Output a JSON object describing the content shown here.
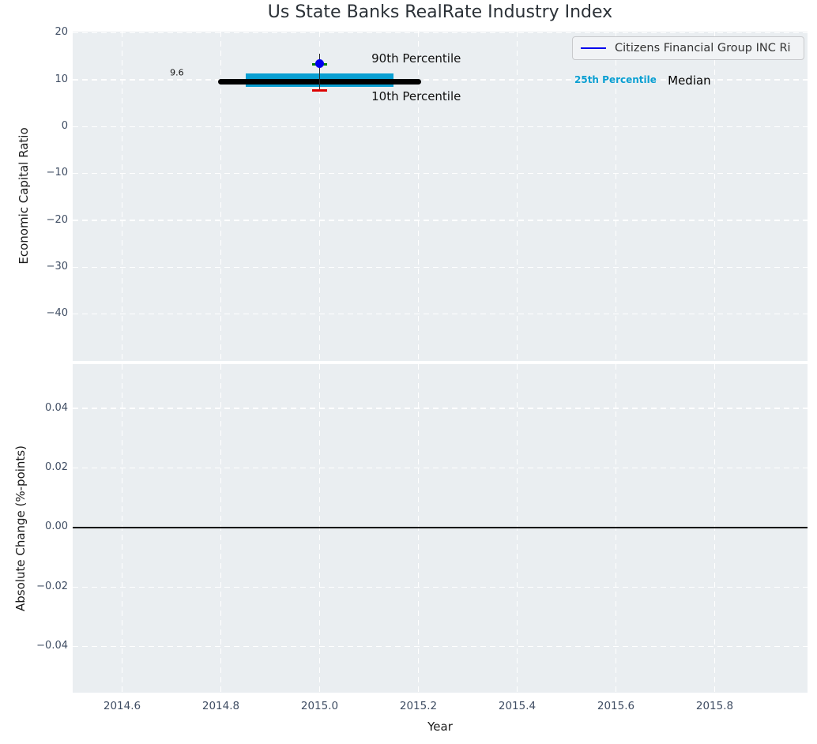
{
  "title": "Us State Banks RealRate Industry Index",
  "style": {
    "figure_bg": "#ffffff",
    "plot_bg": "#eaeef1",
    "grid_color": "#ffffff",
    "tick_label_color": "#3f4d63",
    "axis_label_color": "#1a1a1a",
    "title_color": "#2b3137",
    "legend_bg": "#f1f3f5",
    "legend_border": "#c8c9cc",
    "accent_blue": "#0000ee",
    "accent_cyan": "#0a9fd2",
    "accent_green": "#008000",
    "accent_red": "#dd0000"
  },
  "chart_data": [
    {
      "type": "line",
      "title": "Us State Banks RealRate Industry Index",
      "ylabel": "Economic Capital Ratio",
      "xlabel": "",
      "xlim": [
        2014.5,
        2015.988
      ],
      "ylim": [
        -50.0,
        20.3
      ],
      "grid": "white dashed, on",
      "legend_position": "upper right",
      "legend": {
        "label": "Citizens Financial Group INC Ri",
        "color": "#0000ee"
      },
      "xticks": [
        {
          "label": "2014.6",
          "value": 2014.6
        },
        {
          "label": "2014.8",
          "value": 2014.8
        },
        {
          "label": "2015.0",
          "value": 2015.0
        },
        {
          "label": "2015.2",
          "value": 2015.2
        },
        {
          "label": "2015.4",
          "value": 2015.4
        },
        {
          "label": "2015.6",
          "value": 2015.6
        },
        {
          "label": "2015.8",
          "value": 2015.8
        }
      ],
      "xtick_labels_visible": false,
      "yticks": [
        {
          "label": "20",
          "value": 20
        },
        {
          "label": "10",
          "value": 10
        },
        {
          "label": "0",
          "value": 0
        },
        {
          "label": "−10",
          "value": -10
        },
        {
          "label": "−20",
          "value": -20
        },
        {
          "label": "−30",
          "value": -30
        },
        {
          "label": "−40",
          "value": -40
        }
      ],
      "series": [
        {
          "name": "25th-75th Percentile Band",
          "type": "area",
          "color": "#0a9fd2",
          "x": [
            2014.85,
            2015.15
          ],
          "y_high": [
            11.4,
            11.4
          ],
          "y_low": [
            8.5,
            8.5
          ]
        },
        {
          "name": "Median",
          "type": "line",
          "color": "#000000",
          "linewidth": 7,
          "x": [
            2014.8,
            2015.2
          ],
          "y": [
            9.6,
            9.6
          ]
        },
        {
          "name": "Citizens Financial Group INC Ri",
          "type": "scatter",
          "color": "#0000ee",
          "marker_size": 11,
          "x": [
            2015.0
          ],
          "y": [
            13.5
          ],
          "whisker": {
            "x": 2015.0,
            "y_high": 15.5,
            "y_low": 7.6,
            "line_color": "#2b2b2b",
            "cap_high": {
              "value": 13.3,
              "color": "#008000",
              "meaning": "90th Percentile"
            },
            "cap_low": {
              "value": 7.7,
              "color": "#dd0000",
              "meaning": "10th Percentile"
            }
          }
        }
      ],
      "annotations": [
        {
          "text": "9.6",
          "x": 2014.711,
          "y": 11.5,
          "color": "#111111",
          "size": 11,
          "bold": false,
          "anchor": "center"
        },
        {
          "text": "90th Percentile",
          "x": 2015.105,
          "y": 14.6,
          "color": "#111111",
          "size": 15,
          "bold": false,
          "anchor": "left"
        },
        {
          "text": "10th Percentile",
          "x": 2015.105,
          "y": 6.5,
          "color": "#111111",
          "size": 15,
          "bold": false,
          "anchor": "left"
        },
        {
          "text": "25th Percentile",
          "x": 2015.516,
          "y": 10.1,
          "color": "#0a9fd2",
          "size": 12,
          "bold": true,
          "anchor": "left"
        },
        {
          "text": "Median",
          "x": 2015.705,
          "y": 9.9,
          "color": "#000000",
          "size": 15,
          "bold": false,
          "anchor": "left"
        }
      ]
    },
    {
      "type": "line",
      "title": "",
      "ylabel": "Absolute Change (%-points)",
      "xlabel": "Year",
      "xlim": [
        2014.5,
        2015.988
      ],
      "ylim": [
        -0.0555,
        0.0549
      ],
      "grid": "white dashed, on",
      "xticks": [
        {
          "label": "2014.6",
          "value": 2014.6
        },
        {
          "label": "2014.8",
          "value": 2014.8
        },
        {
          "label": "2015.0",
          "value": 2015.0
        },
        {
          "label": "2015.2",
          "value": 2015.2
        },
        {
          "label": "2015.4",
          "value": 2015.4
        },
        {
          "label": "2015.6",
          "value": 2015.6
        },
        {
          "label": "2015.8",
          "value": 2015.8
        }
      ],
      "xtick_labels_visible": true,
      "yticks": [
        {
          "label": "0.04",
          "value": 0.04
        },
        {
          "label": "0.02",
          "value": 0.02
        },
        {
          "label": "0.00",
          "value": 0.0
        },
        {
          "label": "−0.02",
          "value": -0.02
        },
        {
          "label": "−0.04",
          "value": -0.04
        }
      ],
      "series": [
        {
          "name": "zero-change-baseline",
          "type": "line",
          "color": "#000000",
          "linewidth": 1.5,
          "x": [
            2014.5,
            2015.988
          ],
          "y": [
            0.0,
            0.0
          ]
        }
      ],
      "annotations": []
    }
  ]
}
